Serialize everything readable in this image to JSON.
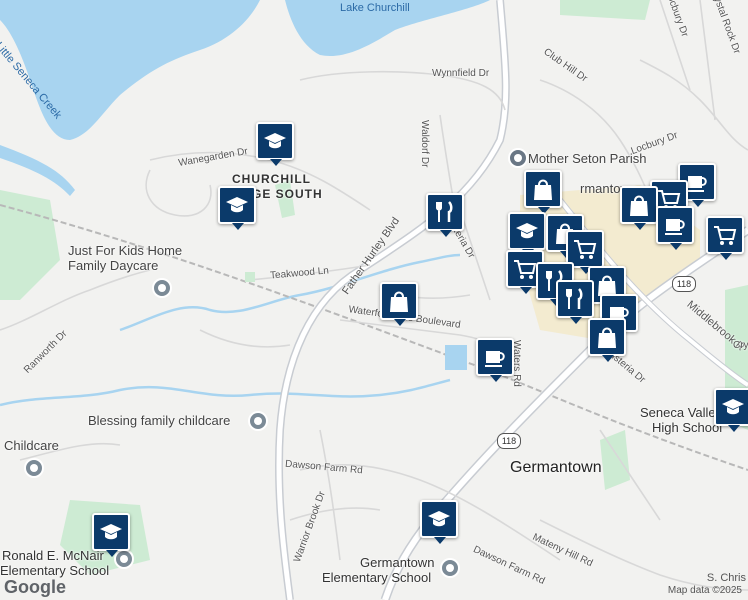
{
  "water_labels": {
    "lake": "Lake Churchill",
    "creek": "Little Seneca Creek"
  },
  "neighborhood": {
    "line1": "CHURCHILL",
    "line2": "LAGE SOUTH"
  },
  "streets": {
    "wynnfield": "Wynnfield Dr",
    "wanegarden": "Wanegarden Dr",
    "waldorf": "Waldorf Dr",
    "club_hill": "Club Hill Dr",
    "locbury_top": "Locbury Dr",
    "locbury": "Locbury Dr",
    "crystal_rock": "Crystal Rock Dr",
    "teakwood": "Teakwood Ln",
    "father_hurley": "Father Hurley Blvd",
    "wisteria1": "Wisteria Dr",
    "wisteria2": "Wisteria Dr",
    "waterford": "Waterford Hills Boulevard",
    "waters": "Waters Rd",
    "middlebrook": "Middlebrook R",
    "ranworth": "Ranworth Dr",
    "dawson1": "Dawson Farm Rd",
    "dawson2": "Dawson Farm Rd",
    "warrior_brook": "Warrior Brook Dr",
    "mateny": "Mateny Hill Rd",
    "cry": "Cry"
  },
  "places": {
    "daycare1": "Just For Kids Home",
    "daycare1b": "Family Daycare",
    "daycare2": "Blessing family childcare",
    "daycare3": "Childcare",
    "parish": "Mother Seton Parish",
    "germantown_cut": "rmantown"
  },
  "town": "Germantown",
  "schools": {
    "seneca": {
      "line1": "Seneca Valley",
      "line2": "High School"
    },
    "ronald": {
      "line1": "Ronald E. McNair",
      "line2": "Elementary School"
    },
    "germantown_es": {
      "line1": "Germantown",
      "line2": "Elementary School"
    }
  },
  "route_shield": "118",
  "route_shield_2": "118",
  "attribution": "Map data ©2025",
  "logo": "Google",
  "bottom_right": "S. Chris",
  "pins": [
    {
      "type": "school"
    },
    {
      "type": "school"
    },
    {
      "type": "restaurant"
    },
    {
      "type": "shopping"
    },
    {
      "type": "cafe"
    },
    {
      "type": "school"
    },
    {
      "type": "school"
    },
    {
      "type": "school"
    },
    {
      "type": "grocery"
    },
    {
      "type": "shopping"
    },
    {
      "type": "cafe"
    },
    {
      "type": "cafe"
    },
    {
      "type": "grocery"
    },
    {
      "type": "shopping"
    }
  ]
}
